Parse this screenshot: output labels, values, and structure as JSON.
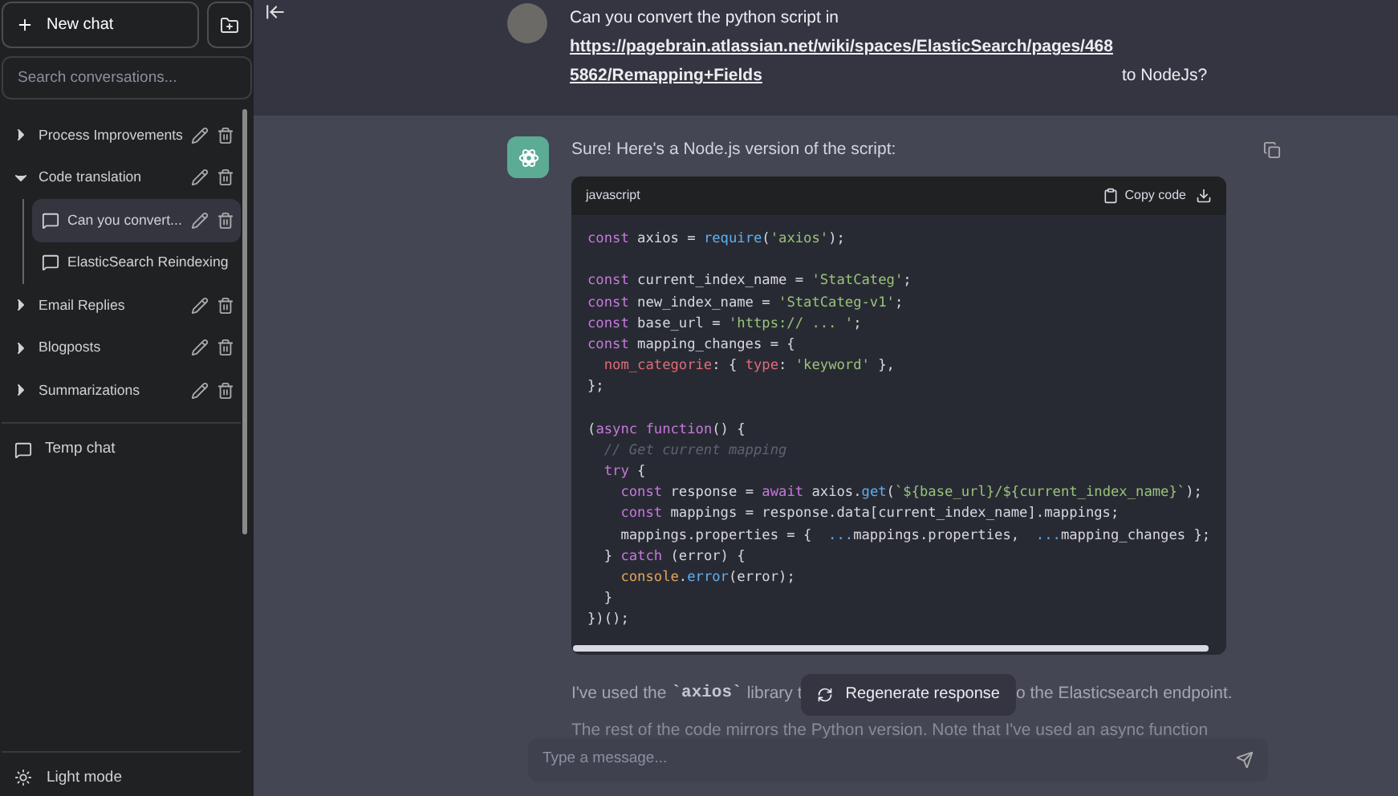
{
  "sidebar": {
    "new_chat": "New chat",
    "search": {
      "placeholder": "Search conversations..."
    },
    "folders": [
      {
        "label": "Process Improvements",
        "expanded": false
      },
      {
        "label": "Code translation",
        "expanded": true,
        "children": [
          {
            "label": "Can you convert...",
            "selected": true
          },
          {
            "label": "ElasticSearch Reindexing",
            "selected": false
          }
        ]
      },
      {
        "label": "Email Replies",
        "expanded": false
      },
      {
        "label": "Blogposts",
        "expanded": false
      },
      {
        "label": "Summarizations",
        "expanded": false
      }
    ],
    "temp_chat": "Temp chat",
    "theme_toggle": "Light mode"
  },
  "user_message": {
    "before": "Can you convert the python script in",
    "link": "https://pagebrain.atlassian.net/wiki/spaces/ElasticSearch/pages/4685862/Remapping+Fields",
    "after": "to NodeJs?"
  },
  "assistant_message": {
    "intro": "Sure! Here's a Node.js version of the script:",
    "code_block": {
      "language": "javascript",
      "copy_label": "Copy code",
      "blocks": [
        [
          [
            {
              "kind": "kw",
              "text": "const"
            },
            {
              "kind": "p",
              "text": " axios = "
            },
            {
              "kind": "fn",
              "text": "require"
            },
            {
              "kind": "p",
              "text": "("
            },
            {
              "kind": "str",
              "text": "'axios'"
            },
            {
              "kind": "p",
              "text": ");"
            }
          ]
        ],
        [
          [
            {
              "kind": "kw",
              "text": "const"
            },
            {
              "kind": "p",
              "text": " current_index_name = "
            },
            {
              "kind": "str",
              "text": "'StatCateg'"
            },
            {
              "kind": "p",
              "text": ";"
            }
          ],
          [
            {
              "kind": "kw",
              "text": "const"
            },
            {
              "kind": "p",
              "text": " new_index_name = "
            },
            {
              "kind": "str",
              "text": "'StatCateg-v1'"
            },
            {
              "kind": "p",
              "text": ";"
            }
          ],
          [
            {
              "kind": "kw",
              "text": "const"
            },
            {
              "kind": "p",
              "text": " base_url = "
            },
            {
              "kind": "str",
              "text": "'https:// ... '"
            },
            {
              "kind": "p",
              "text": ";"
            }
          ],
          [
            {
              "kind": "kw",
              "text": "const"
            },
            {
              "kind": "p",
              "text": " mapping_changes = {"
            }
          ],
          [
            {
              "kind": "prop",
              "text": "  nom_categorie"
            },
            {
              "kind": "p",
              "text": ": { "
            },
            {
              "kind": "prop",
              "text": "type"
            },
            {
              "kind": "p",
              "text": ": "
            },
            {
              "kind": "str",
              "text": "'keyword'"
            },
            {
              "kind": "p",
              "text": " },"
            }
          ],
          [
            {
              "kind": "p",
              "text": "};"
            }
          ]
        ],
        [
          [
            {
              "kind": "p",
              "text": "("
            },
            {
              "kind": "kw",
              "text": "async function"
            },
            {
              "kind": "p",
              "text": "() {"
            }
          ],
          [
            {
              "kind": "cm",
              "text": "  // Get current mapping"
            }
          ],
          [
            {
              "kind": "kw",
              "text": "  try"
            },
            {
              "kind": "p",
              "text": " {"
            }
          ],
          [
            {
              "kind": "kw",
              "text": "    const"
            },
            {
              "kind": "p",
              "text": " response = "
            },
            {
              "kind": "kw",
              "text": "await"
            },
            {
              "kind": "p",
              "text": " axios."
            },
            {
              "kind": "fn",
              "text": "get"
            },
            {
              "kind": "p",
              "text": "("
            },
            {
              "kind": "str",
              "text": "`${base_url}/${current_index_name}`"
            },
            {
              "kind": "p",
              "text": ");"
            }
          ],
          [
            {
              "kind": "kw",
              "text": "    const"
            },
            {
              "kind": "p",
              "text": " mappings = response.data[current_index_name].mappings;"
            }
          ],
          [
            {
              "kind": "p",
              "text": "    mappings.properties = {  "
            },
            {
              "kind": "fn",
              "text": "..."
            },
            {
              "kind": "p",
              "text": "mappings.properties,  "
            },
            {
              "kind": "fn",
              "text": "..."
            },
            {
              "kind": "p",
              "text": "mapping_changes };"
            }
          ],
          [
            {
              "kind": "p",
              "text": "  } "
            },
            {
              "kind": "kw",
              "text": "catch"
            },
            {
              "kind": "p",
              "text": " (error) {"
            }
          ],
          [
            {
              "kind": "var",
              "text": "    console"
            },
            {
              "kind": "p",
              "text": "."
            },
            {
              "kind": "fn",
              "text": "error"
            },
            {
              "kind": "p",
              "text": "(error);"
            }
          ],
          [
            {
              "kind": "p",
              "text": "  }"
            }
          ],
          [
            {
              "kind": "p",
              "text": "})();"
            }
          ]
        ]
      ]
    },
    "followup": {
      "before": "I've used the",
      "code": "`axios`",
      "after": "library t",
      "tail": "o the Elasticsearch endpoint.",
      "line2": "The rest of the code mirrors the Python version. Note that I've used an async function"
    }
  },
  "regenerate": "Regenerate response",
  "composer": {
    "placeholder": "Type a message..."
  }
}
